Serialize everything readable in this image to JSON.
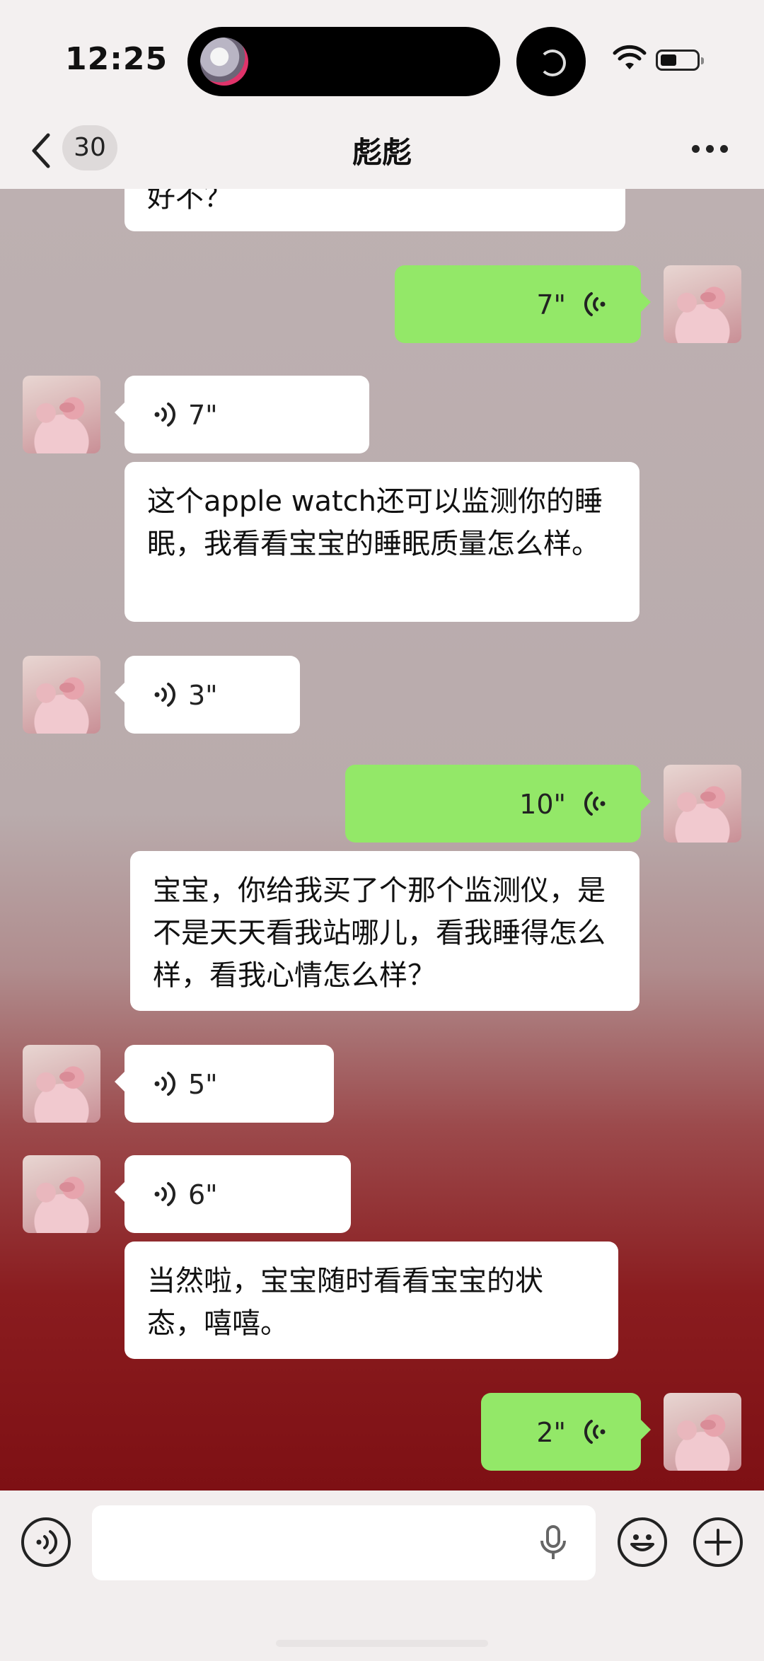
{
  "status_bar": {
    "time": "12:25"
  },
  "nav": {
    "title": "彪彪",
    "unread_count": "30"
  },
  "messages": [
    {
      "side": "in",
      "type": "text",
      "text": "好不？"
    },
    {
      "side": "out",
      "type": "voice",
      "duration": "7\""
    },
    {
      "side": "in",
      "type": "voice",
      "duration": "7\""
    },
    {
      "side": "in",
      "type": "text",
      "text": "这个apple watch还可以监测你的睡眠，我看看宝宝的睡眠质量怎么样。"
    },
    {
      "side": "in",
      "type": "voice",
      "duration": "3\""
    },
    {
      "side": "out",
      "type": "voice",
      "duration": "10\""
    },
    {
      "side": "out",
      "type": "text",
      "text": "宝宝，你给我买了个那个监测仪，是不是天天看我站哪儿，看我睡得怎么样，看我心情怎么样？"
    },
    {
      "side": "in",
      "type": "voice",
      "duration": "5\""
    },
    {
      "side": "in",
      "type": "voice",
      "duration": "6\""
    },
    {
      "side": "in",
      "type": "text",
      "text": "当然啦，宝宝随时看看宝宝的状态，嘻嘻。"
    },
    {
      "side": "out",
      "type": "voice",
      "duration": "2\""
    }
  ],
  "colors": {
    "outgoing_bubble": "#93e868",
    "incoming_bubble": "#ffffff"
  },
  "icons": [
    "back-icon",
    "more-icon",
    "voice-input-icon",
    "mic-icon",
    "emoji-icon",
    "plus-icon",
    "wifi-icon",
    "battery-icon"
  ]
}
